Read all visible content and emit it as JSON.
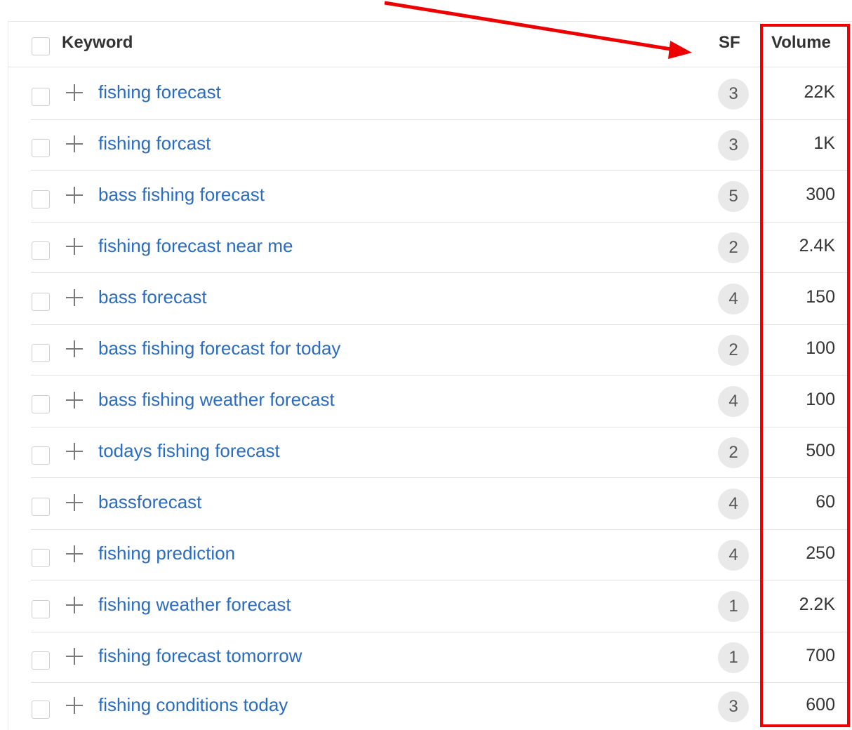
{
  "header": {
    "keyword_label": "Keyword",
    "sf_label": "SF",
    "volume_label": "Volume"
  },
  "rows": [
    {
      "keyword": "fishing forecast",
      "sf": "3",
      "volume": "22K"
    },
    {
      "keyword": "fishing forcast",
      "sf": "3",
      "volume": "1K"
    },
    {
      "keyword": "bass fishing forecast",
      "sf": "5",
      "volume": "300"
    },
    {
      "keyword": "fishing forecast near me",
      "sf": "2",
      "volume": "2.4K"
    },
    {
      "keyword": "bass forecast",
      "sf": "4",
      "volume": "150"
    },
    {
      "keyword": "bass fishing forecast for today",
      "sf": "2",
      "volume": "100"
    },
    {
      "keyword": "bass fishing weather forecast",
      "sf": "4",
      "volume": "100"
    },
    {
      "keyword": "todays fishing forecast",
      "sf": "2",
      "volume": "500"
    },
    {
      "keyword": "bassforecast",
      "sf": "4",
      "volume": "60"
    },
    {
      "keyword": "fishing prediction",
      "sf": "4",
      "volume": "250"
    },
    {
      "keyword": "fishing weather forecast",
      "sf": "1",
      "volume": "2.2K"
    },
    {
      "keyword": "fishing forecast tomorrow",
      "sf": "1",
      "volume": "700"
    },
    {
      "keyword": "fishing conditions today",
      "sf": "3",
      "volume": "600"
    }
  ],
  "colors": {
    "link": "#2b6cbf",
    "annotation": "#ee0000",
    "badge_bg": "#e9e9e9"
  },
  "icons": {
    "add": "plus-icon",
    "annotation_arrow": "red-arrow-icon"
  }
}
